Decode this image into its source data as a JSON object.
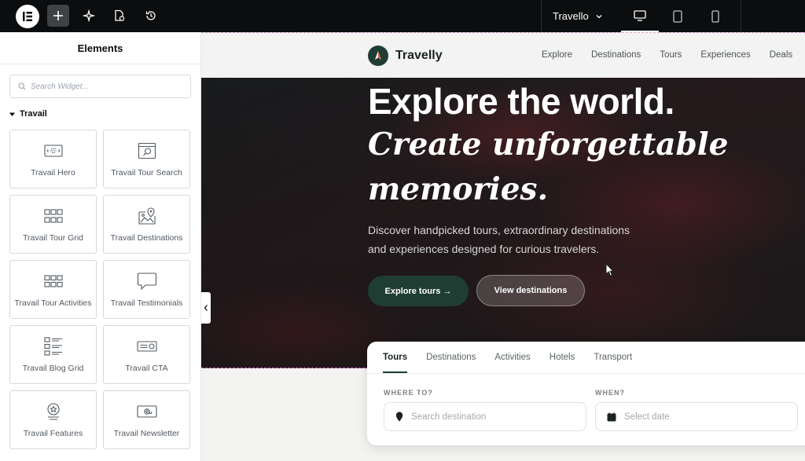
{
  "topbar": {
    "site_name": "Travello",
    "icons": [
      "elementor-logo-icon",
      "add-element-icon",
      "ai-sparkle-icon",
      "page-settings-icon",
      "history-icon",
      "chevron-down-icon",
      "desktop-icon",
      "tablet-icon",
      "mobile-icon"
    ],
    "active_device": "desktop"
  },
  "panel": {
    "title": "Elements",
    "search_placeholder": "Search Widget...",
    "category": "Travail",
    "widgets": [
      {
        "label": "Travail Hero",
        "icon": "hero-icon"
      },
      {
        "label": "Travail Tour Search",
        "icon": "tour-search-icon"
      },
      {
        "label": "Travail Tour Grid",
        "icon": "tour-grid-icon"
      },
      {
        "label": "Travail Destinations",
        "icon": "destinations-map-icon"
      },
      {
        "label": "Travail Tour Activities",
        "icon": "tour-activities-icon"
      },
      {
        "label": "Travail Testimonials",
        "icon": "testimonials-speech-icon"
      },
      {
        "label": "Travail Blog Grid",
        "icon": "blog-grid-icon"
      },
      {
        "label": "Travail CTA",
        "icon": "cta-icon"
      },
      {
        "label": "Travail Features",
        "icon": "features-badge-icon"
      },
      {
        "label": "Travail Newsletter",
        "icon": "newsletter-icon"
      }
    ]
  },
  "site": {
    "brand": "Travelly",
    "nav": [
      "Explore",
      "Destinations",
      "Tours",
      "Experiences",
      "Deals"
    ],
    "hero": {
      "title": "Explore the world.",
      "italic_line1": "Create unforgettable",
      "italic_line2": "memories.",
      "subtitle_line1": "Discover handpicked tours, extraordinary destinations",
      "subtitle_line2": "and experiences designed for curious travelers.",
      "primary_button": "Explore tours →",
      "secondary_button": "View destinations"
    },
    "search_card": {
      "tabs": [
        "Tours",
        "Destinations",
        "Activities",
        "Hotels",
        "Transport"
      ],
      "active_tab": "Tours",
      "where_label": "WHERE TO?",
      "where_placeholder": "Search destination",
      "when_label": "WHEN?",
      "when_placeholder": "Select date"
    }
  },
  "colors": {
    "accent": "#1f3d33",
    "topbar": "#0c0d0e",
    "selection_outline": "#d65fb4"
  }
}
